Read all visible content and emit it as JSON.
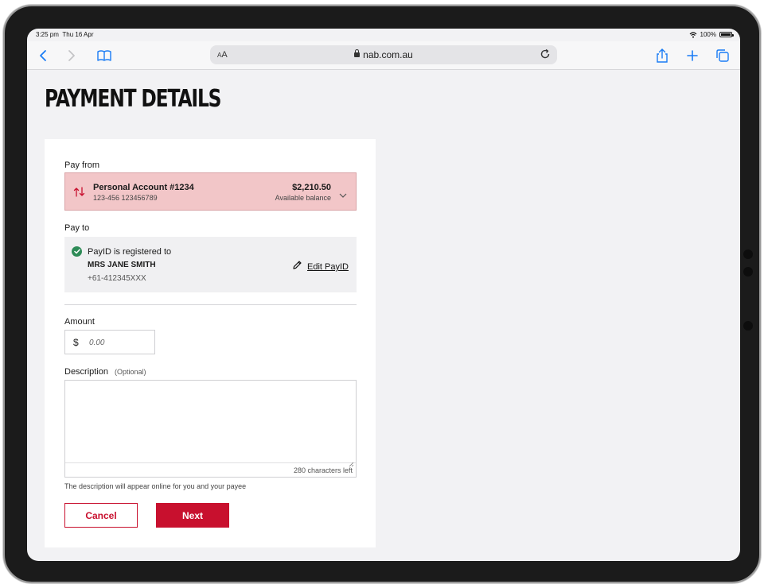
{
  "status_bar": {
    "time": "3:25 pm",
    "date": "Thu 16 Apr",
    "battery": "100%",
    "battery_level": 1.0
  },
  "browser": {
    "url": "nab.com.au",
    "text_size_label_small": "A",
    "text_size_label_large": "A",
    "icons": [
      "back-icon",
      "forward-icon",
      "bookmarks-icon",
      "lock-icon",
      "reload-icon",
      "share-icon",
      "new-tab-icon",
      "tabs-icon"
    ]
  },
  "page": {
    "title": "PAYMENT DETAILS"
  },
  "pay_from": {
    "label": "Pay from",
    "account_name": "Personal Account #1234",
    "account_number": "123-456 123456789",
    "balance": "$2,210.50",
    "balance_label": "Available balance"
  },
  "pay_to": {
    "label": "Pay to",
    "registered_text": "PayID is registered to",
    "payee_name": "MRS JANE SMITH",
    "payee_phone": "+61-412345XXX",
    "edit_label": "Edit PayID"
  },
  "amount": {
    "label": "Amount",
    "currency_symbol": "$",
    "value": "",
    "placeholder": "0.00"
  },
  "description": {
    "label": "Description",
    "optional_label": "(Optional)",
    "value": "",
    "chars_left": "280 characters left",
    "note": "The description will appear online for you and your payee"
  },
  "actions": {
    "cancel_label": "Cancel",
    "next_label": "Next"
  },
  "colors": {
    "brand_red": "#c8102e",
    "selected_account_bg": "#f2c6c8",
    "success_green": "#2e8b57",
    "page_bg": "#f2f2f4",
    "ios_blue": "#1a7cf5"
  }
}
